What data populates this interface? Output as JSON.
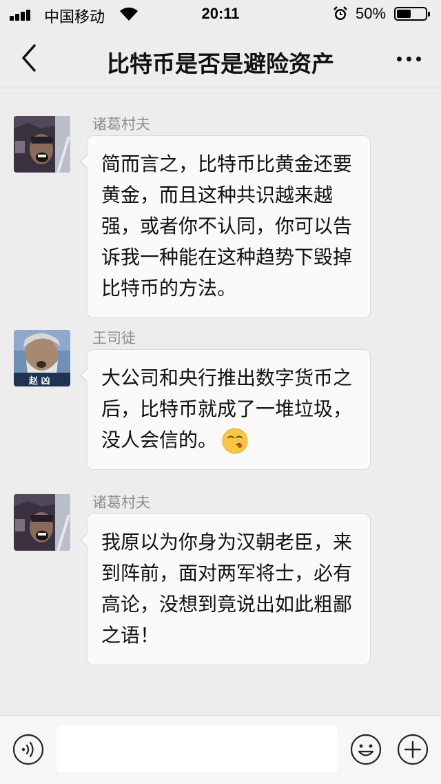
{
  "status_bar": {
    "carrier": "中国移动",
    "time": "20:11",
    "battery_percent_text": "50%",
    "battery_level": 0.5
  },
  "nav": {
    "title": "比特币是否是避险资产"
  },
  "messages": [
    {
      "sender": "诸葛村夫",
      "text": "简而言之，比特币比黄金还要黄金，而且这种共识越来越强，或者你不认同，你可以告诉我一种能在这种趋势下毁掉比特币的方法。",
      "emoji": null
    },
    {
      "sender": "王司徒",
      "avatar_caption": "赵 凶",
      "text": "大公司和央行推出数字货币之后，比特币就成了一堆垃圾，没人会信的。",
      "emoji": "smirk-face-icon"
    },
    {
      "sender": "诸葛村夫",
      "text": "我原以为你身为汉朝老臣，来到阵前，面对两军将士，必有高论，没想到竟说出如此粗鄙之语！",
      "emoji": null
    }
  ],
  "input_bar": {
    "placeholder": ""
  },
  "colors": {
    "background": "#ededed",
    "bubble": "#fafafa",
    "bubble_border": "#d9d9d9",
    "sender_name": "#8e8e8e",
    "emoji_yellow": "#f7c744"
  }
}
